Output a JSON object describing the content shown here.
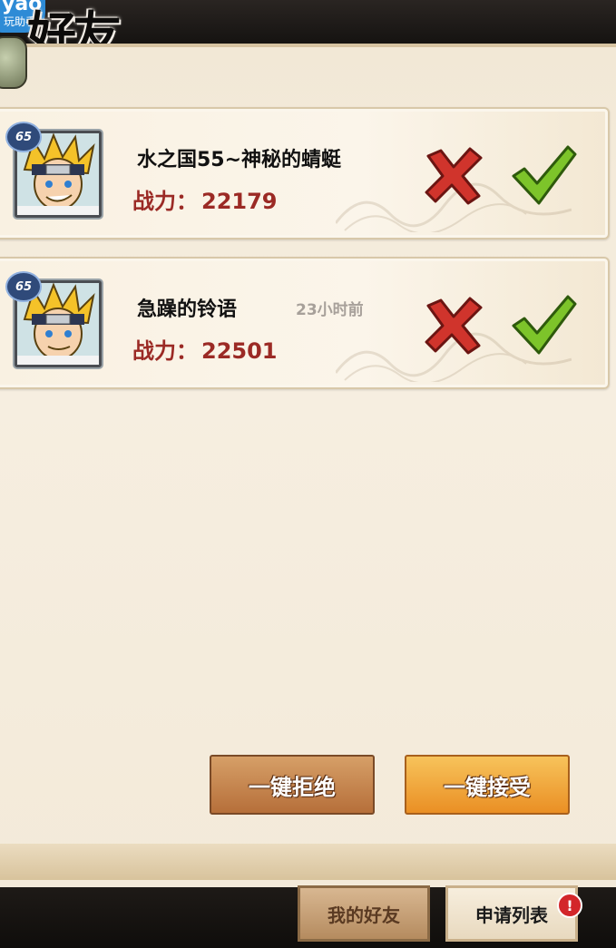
{
  "header": {
    "title": "好友",
    "app_badge_icon": "yao",
    "app_badge_label": "玩助手"
  },
  "requests": [
    {
      "level": "65",
      "name": "水之国55~神秘的蜻蜓",
      "time": "",
      "power_label": "战力：",
      "power_value": "22179"
    },
    {
      "level": "65",
      "name": "急躁的铃语",
      "time": "23小时前",
      "power_label": "战力：",
      "power_value": "22501"
    }
  ],
  "actions": {
    "reject_all": "一键拒绝",
    "accept_all": "一键接受"
  },
  "tabs": {
    "friends": "我的好友",
    "requests": "申请列表",
    "notice": "!"
  },
  "colors": {
    "power_text": "#9b2a25",
    "reject_icon": "#d0342c",
    "accept_icon": "#7dc42a"
  }
}
